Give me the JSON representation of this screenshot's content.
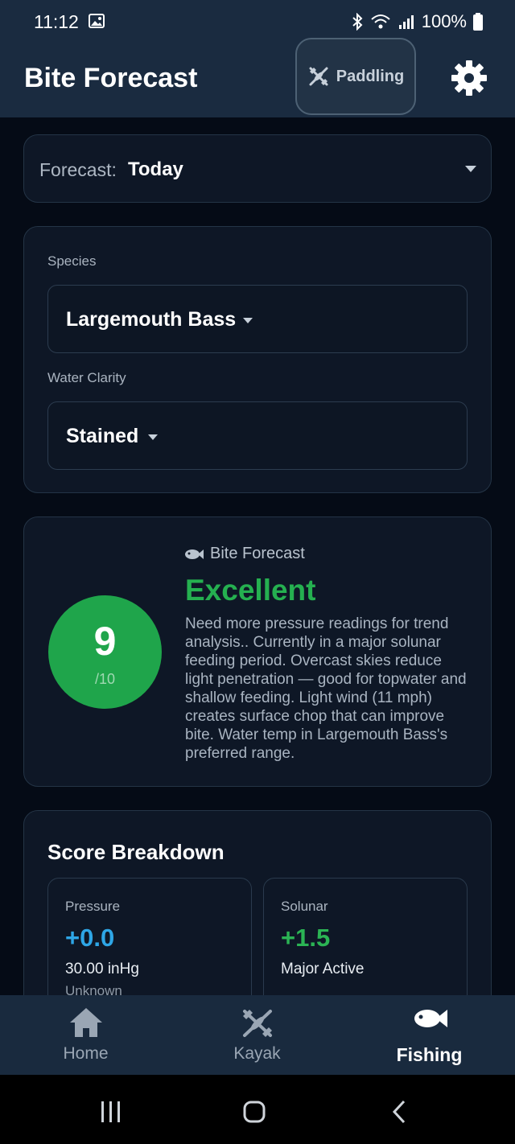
{
  "status_bar": {
    "time": "11:12",
    "battery": "100%"
  },
  "header": {
    "title": "Bite Forecast",
    "paddling_label": "Paddling"
  },
  "forecast_select": {
    "label": "Forecast:",
    "value": "Today"
  },
  "filters": {
    "species_label": "Species",
    "species_value": "Largemouth Bass",
    "clarity_label": "Water Clarity",
    "clarity_value": "Stained"
  },
  "bite_forecast": {
    "heading": "Bite Forecast",
    "score": "9",
    "score_max": "/10",
    "rating": "Excellent",
    "description": "Need more pressure readings for trend analysis.. Currently in a major solunar feeding period. Overcast skies reduce light penetration — good for topwater and shallow feeding. Light wind (11 mph) creates surface chop that can improve bite. Water temp in Largemouth Bass's preferred range."
  },
  "score_breakdown": {
    "title": "Score Breakdown",
    "metrics": [
      {
        "label": "Pressure",
        "value": "+0.0",
        "detail": "30.00 inHg",
        "detail2": "Unknown",
        "color": "#2ea6e6"
      },
      {
        "label": "Solunar",
        "value": "+1.5",
        "detail": "Major Active",
        "color": "#2bb454"
      }
    ]
  },
  "bottom_nav": {
    "items": [
      {
        "label": "Home",
        "icon": "home-icon"
      },
      {
        "label": "Kayak",
        "icon": "kayak-icon"
      },
      {
        "label": "Fishing",
        "icon": "fish-icon",
        "active": true
      }
    ]
  },
  "colors": {
    "accent_green": "#25b050",
    "score_circle": "#1fa54b",
    "header_bg": "#1a2b40",
    "background": "#050b16"
  }
}
